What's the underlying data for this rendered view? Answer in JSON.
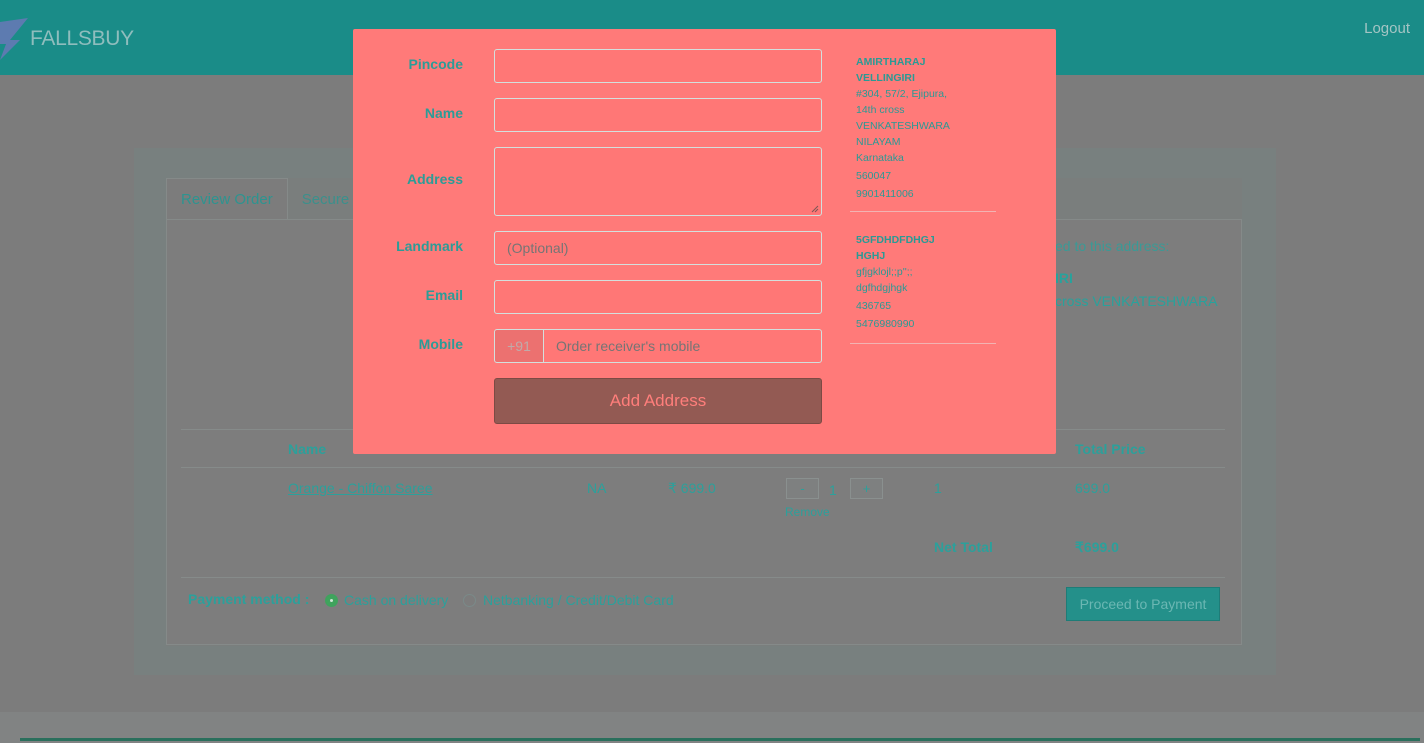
{
  "header": {
    "brand": "FALLSBUY",
    "logout_label": "Logout"
  },
  "tabs": [
    {
      "label": "Review Order"
    },
    {
      "label": "Secure P"
    }
  ],
  "delivery": {
    "hint": "ed to this address:",
    "name": "IRI",
    "line": "cross VENKATESHWARA"
  },
  "table": {
    "headers": {
      "name": "Name",
      "total_price": "Total Price"
    },
    "row": {
      "product": "Orange - Chiffon Saree",
      "size": "NA",
      "price": "₹ 699.0",
      "qty_minus": "-",
      "qty": "1",
      "qty_plus": "+",
      "count": "1",
      "total": "699.0",
      "remove": "Remove"
    },
    "net_total_label": "Net Total",
    "net_total_value": "₹699.0"
  },
  "payment": {
    "label": "Payment method :",
    "options": [
      {
        "label": "Cash on delivery",
        "checked": true
      },
      {
        "label": "Netbanking / Credit/Debit Card",
        "checked": false
      }
    ],
    "proceed_label": "Proceed to Payment"
  },
  "modal": {
    "fields": {
      "pincode": {
        "label": "Pincode",
        "value": "",
        "placeholder": ""
      },
      "name": {
        "label": "Name",
        "value": "",
        "placeholder": ""
      },
      "address": {
        "label": "Address",
        "value": "",
        "placeholder": ""
      },
      "landmark": {
        "label": "Landmark",
        "value": "",
        "placeholder": "(Optional)"
      },
      "email": {
        "label": "Email",
        "value": "",
        "placeholder": ""
      },
      "mobile": {
        "label": "Mobile",
        "prefix": "+91",
        "value": "",
        "placeholder": "Order receiver's mobile"
      }
    },
    "add_button": "Add Address",
    "saved_addresses": [
      {
        "name_line1": "AMIRTHARAJ",
        "name_line2": "VELLINGIRI",
        "lines": [
          "#304, 57/2, Ejipura,",
          "14th cross",
          "VENKATESHWARA",
          "NILAYAM",
          "Karnataka",
          "560047",
          "9901411006"
        ]
      },
      {
        "name_line1": "5GFDHDFDHGJ",
        "name_line2": "HGHJ",
        "lines": [
          "gfjgklojl;;p'';;",
          "dgfhdgjhgk",
          "436765",
          "5476980990"
        ]
      }
    ]
  },
  "colors": {
    "header_bg": "#1a8c88",
    "modal_bg": "#ff7a79",
    "accent_text": "#2ca09b",
    "add_button_bg": "#935a53",
    "proceed_button_bg": "#24908a"
  }
}
